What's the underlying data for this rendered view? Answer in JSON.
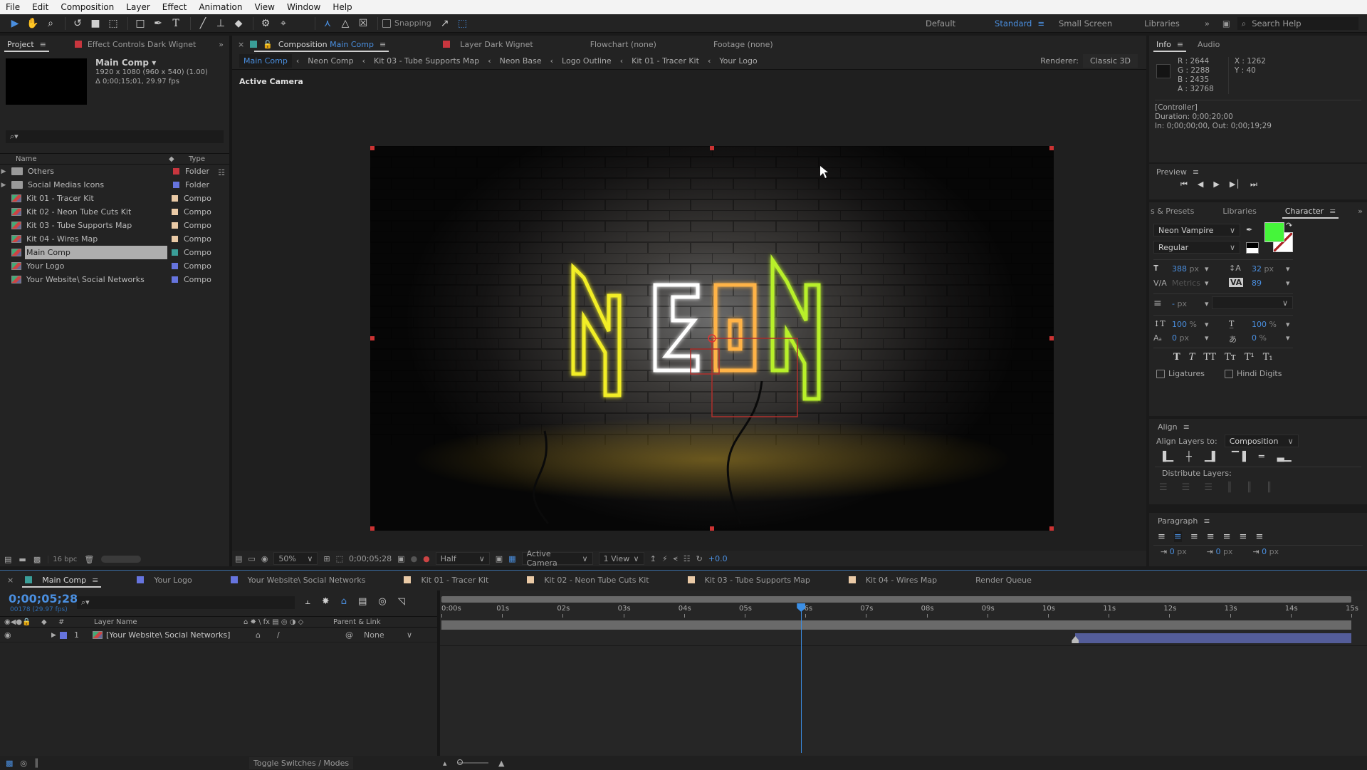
{
  "menubar": [
    "File",
    "Edit",
    "Composition",
    "Layer",
    "Effect",
    "Animation",
    "View",
    "Window",
    "Help"
  ],
  "toolbar": {
    "snapping_label": "Snapping",
    "snapping_checked": false
  },
  "workspaces": {
    "items": [
      "Default",
      "Standard",
      "Small Screen",
      "Libraries"
    ],
    "active": "Standard",
    "search_placeholder": "Search Help"
  },
  "project": {
    "tab_label": "Project",
    "effect_controls_label": "Effect Controls Dark Wignet",
    "selected_name": "Main Comp",
    "selected_dims": "1920 x 1080  (960 x 540) (1.00)",
    "selected_duration": "Δ 0;00;15;01, 29.97 fps",
    "search_placeholder": "",
    "col_name": "Name",
    "col_type": "Type",
    "items": [
      {
        "name": "Others",
        "type": "Folder",
        "kind": "folder",
        "color": "#c8363e",
        "selected": false
      },
      {
        "name": "Social Medias Icons",
        "type": "Folder",
        "kind": "folder",
        "color": "#6674de",
        "selected": false
      },
      {
        "name": "Kit 01 - Tracer Kit",
        "type": "Compo",
        "kind": "comp",
        "color": "#eacaa6",
        "selected": false
      },
      {
        "name": "Kit 02 - Neon Tube Cuts Kit",
        "type": "Compo",
        "kind": "comp",
        "color": "#eacaa6",
        "selected": false
      },
      {
        "name": "Kit 03 - Tube Supports Map",
        "type": "Compo",
        "kind": "comp",
        "color": "#eacaa6",
        "selected": false
      },
      {
        "name": "Kit 04 - Wires Map",
        "type": "Compo",
        "kind": "comp",
        "color": "#eacaa6",
        "selected": false
      },
      {
        "name": "Main Comp",
        "type": "Compo",
        "kind": "comp",
        "color": "#3a9e98",
        "selected": true
      },
      {
        "name": "Your Logo",
        "type": "Compo",
        "kind": "comp",
        "color": "#6674de",
        "selected": false
      },
      {
        "name": "Your Website\\ Social Networks",
        "type": "Compo",
        "kind": "comp",
        "color": "#6674de",
        "selected": false
      }
    ],
    "bpc": "16 bpc"
  },
  "composition": {
    "tab_prefix": "Composition",
    "tab_name": "Main Comp",
    "other_tabs": [
      {
        "label": "Layer  Dark Wignet",
        "color": "#c8363e"
      },
      {
        "label": "Flowchart  (none)",
        "color": null
      },
      {
        "label": "Footage  (none)",
        "color": null
      }
    ],
    "breadcrumbs": [
      "Main Comp",
      "Neon Comp",
      "Kit 03 - Tube Supports Map",
      "Neon Base",
      "Logo Outline",
      "Kit 01 - Tracer Kit",
      "Your Logo"
    ],
    "renderer_label": "Renderer:",
    "renderer_value": "Classic 3D",
    "camera_label": "Active Camera",
    "neon_text": [
      "N",
      "E",
      "O",
      "N"
    ],
    "neon_colors": [
      "#f2ee25",
      "#ffffff",
      "#ffb347",
      "#b8f02a"
    ]
  },
  "viewer_bar": {
    "zoom": "50%",
    "timecode": "0;00;05;28",
    "resolution": "Half",
    "view": "Active Camera",
    "layout": "1 View",
    "exposure": "+0.0"
  },
  "info": {
    "tab_label": "Info",
    "audio_label": "Audio",
    "r": "R :  2644",
    "g": "G :  2288",
    "b": "B :  2435",
    "a": "A :  32768",
    "x": "X : 1262",
    "y": "Y :  40",
    "layer": "[Controller]",
    "duration": "Duration: 0;00;20;00",
    "inout": "In: 0;00;00;00, Out: 0;00;19;29"
  },
  "preview": {
    "label": "Preview"
  },
  "character": {
    "tabs": [
      "s & Presets",
      "Libraries",
      "Character"
    ],
    "font": "Neon Vampire",
    "style": "Regular",
    "fill_color": "#45f53a",
    "size": "388",
    "size_unit": "px",
    "leading": "32",
    "leading_unit": "px",
    "kerning": "Metrics",
    "tracking": "89",
    "stroke": "-",
    "stroke_unit": "px",
    "vscale": "100",
    "hscale": "100",
    "baseline": "0",
    "tsume": "0",
    "pct": "%",
    "px": "px",
    "ligatures": "Ligatures",
    "hindi": "Hindi Digits"
  },
  "align": {
    "label": "Align",
    "align_to_label": "Align Layers to:",
    "align_to": "Composition",
    "distribute_label": "Distribute Layers:"
  },
  "paragraph": {
    "label": "Paragraph",
    "indent_left": "0",
    "indent_first": "0",
    "space_before": "0",
    "unit": "px"
  },
  "timeline": {
    "tabs": [
      {
        "label": "Main Comp",
        "color": "#3a9e98",
        "active": true
      },
      {
        "label": "Your Logo",
        "color": "#6674de",
        "active": false
      },
      {
        "label": "Your Website\\ Social Networks",
        "color": "#6674de",
        "active": false
      },
      {
        "label": "Kit 01 - Tracer Kit",
        "color": "#eacaa6",
        "active": false
      },
      {
        "label": "Kit 02 - Neon Tube Cuts Kit",
        "color": "#eacaa6",
        "active": false
      },
      {
        "label": "Kit 03 - Tube Supports Map",
        "color": "#eacaa6",
        "active": false
      },
      {
        "label": "Kit 04 - Wires Map",
        "color": "#eacaa6",
        "active": false
      },
      {
        "label": "Render Queue",
        "color": null,
        "active": false
      }
    ],
    "timecode": "0;00;05;28",
    "frame_info": "00178 (29.97 fps)",
    "col_layer_name": "Layer Name",
    "col_parent": "Parent & Link",
    "col_num": "#",
    "layers": [
      {
        "num": "1",
        "name": "[Your Website\\ Social Networks]",
        "color": "#6674de",
        "parent": "None",
        "bar_start_sec": 10.45,
        "bar_end_sec": 15
      }
    ],
    "ruler": [
      "0:00s",
      "01s",
      "02s",
      "03s",
      "04s",
      "05s",
      "06s",
      "07s",
      "08s",
      "09s",
      "10s",
      "11s",
      "12s",
      "13s",
      "14s",
      "15s"
    ],
    "duration_sec": 15,
    "playhead_sec": 5.93,
    "toggle_label": "Toggle Switches / Modes"
  }
}
